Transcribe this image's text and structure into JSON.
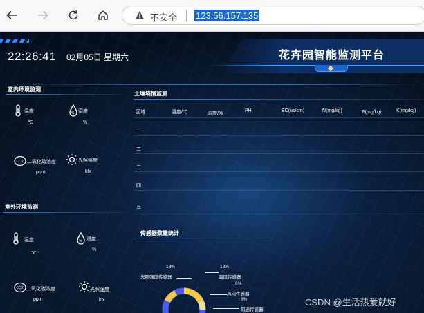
{
  "browser": {
    "insecure_label": "不安全",
    "url": "123.56.157.135"
  },
  "header": {
    "time": "22:26:41",
    "date": "02月05日  星期六",
    "title": "花卉园智能监测平台"
  },
  "indoor": {
    "title": "室内环境监测",
    "sensors": [
      {
        "label": "温度",
        "unit": "℃",
        "icon": "thermometer-icon"
      },
      {
        "label": "湿度",
        "unit": "%",
        "icon": "humidity-drop-icon"
      },
      {
        "label": "二氧化碳浓度",
        "unit": "ppm",
        "icon": "co2-icon"
      },
      {
        "label": "光照强度",
        "unit": "klx",
        "icon": "sun-icon"
      }
    ]
  },
  "outdoor": {
    "title": "室外环境监测",
    "sensors": [
      {
        "label": "温度",
        "unit": "℃",
        "icon": "thermometer-icon"
      },
      {
        "label": "湿度",
        "unit": "%",
        "icon": "humidity-drop-icon"
      },
      {
        "label": "二氧化碳浓度",
        "unit": "ppm",
        "icon": "co2-icon"
      },
      {
        "label": "光照强度",
        "unit": "klx",
        "icon": "sun-icon"
      }
    ]
  },
  "soil": {
    "title": "土壤墒情监测",
    "columns": [
      "区域",
      "温度/℃",
      "湿度/%",
      "PH",
      "EC(us/cm)",
      "N(mg/kg)",
      "P(mg/kg)",
      "K(mg/kg)"
    ],
    "rows": [
      "一",
      "二",
      "三",
      "四",
      "五"
    ]
  },
  "sensors_stats": {
    "title": "传感器数量统计",
    "labels": [
      {
        "name": "光照强度传感器",
        "percent": "13%"
      },
      {
        "name": "温度传感器",
        "percent": "13%"
      },
      {
        "name": "风向传感器",
        "percent": "6%"
      },
      {
        "name": "风速传感器",
        "percent": "6%"
      }
    ],
    "colors": {
      "yellow": "#f2c94c",
      "blue": "#4a5ce6"
    }
  },
  "watermark": "CSDN @生活热爱就好"
}
